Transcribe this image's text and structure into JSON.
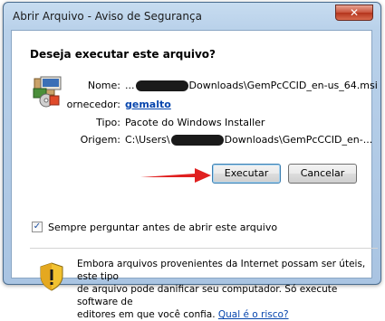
{
  "window": {
    "title": "Abrir Arquivo - Aviso de Segurança",
    "close_glyph": "✕"
  },
  "dialog": {
    "question": "Deseja executar este arquivo?",
    "icon": "installer-package-icon",
    "fields": {
      "name": {
        "label": "Nome:",
        "prefix": "...",
        "suffix": "Downloads\\GemPcCCID_en-us_64.msi"
      },
      "publisher": {
        "label": "ornecedor:",
        "value": "gemalto"
      },
      "type": {
        "label": "Tipo:",
        "value": "Pacote do Windows Installer"
      },
      "origin": {
        "label": "Origem:",
        "prefix": "C:\\Users\\",
        "suffix": "Downloads\\GemPcCCID_en-..."
      }
    },
    "buttons": {
      "run": "Executar",
      "cancel": "Cancelar"
    },
    "checkbox": {
      "label": "Sempre perguntar antes de abrir este arquivo",
      "checked": true,
      "glyph": "✓"
    },
    "warning": {
      "icon": "security-shield-warning-icon",
      "text_1": "Embora arquivos provenientes da Internet possam ser úteis, este tipo",
      "text_2": "de arquivo pode danificar seu computador. Só execute software de",
      "text_3": "editores em que você confia.",
      "link": "Qual é o risco?"
    }
  },
  "colors": {
    "arrow": "#e02020",
    "link": "#0645ad"
  }
}
